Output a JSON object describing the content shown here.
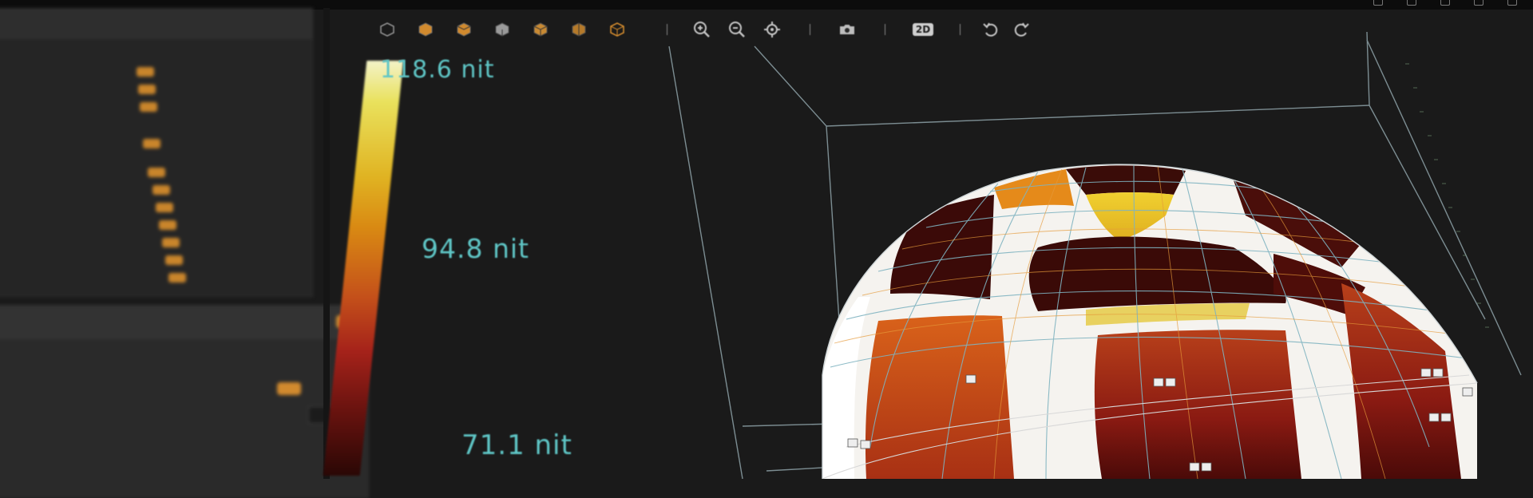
{
  "toolbar": {
    "view_buttons": [
      {
        "icon": "view-cube-icon-1"
      },
      {
        "icon": "view-cube-icon-2"
      },
      {
        "icon": "view-cube-icon-3"
      },
      {
        "icon": "view-cube-icon-4"
      },
      {
        "icon": "view-cube-icon-5"
      },
      {
        "icon": "view-cube-icon-6"
      },
      {
        "icon": "view-cube-icon-7"
      }
    ],
    "zoom_in_icon": "zoom-in-icon",
    "zoom_out_icon": "zoom-out-icon",
    "center_icon": "crosshair-icon",
    "camera_icon": "camera-icon",
    "mode_2d_label": "2D",
    "undo_icon": "undo-icon",
    "redo_icon": "redo-icon"
  },
  "color_scale": {
    "max_label": "118.6 nit",
    "mid_label": "94.8 nit",
    "min_label": "71.1 nit"
  },
  "colors": {
    "accent": "#d18a2e",
    "scale_text": "#5fc6c6",
    "grid_line": "#7fb3c0",
    "background": "#1a1a1a"
  }
}
